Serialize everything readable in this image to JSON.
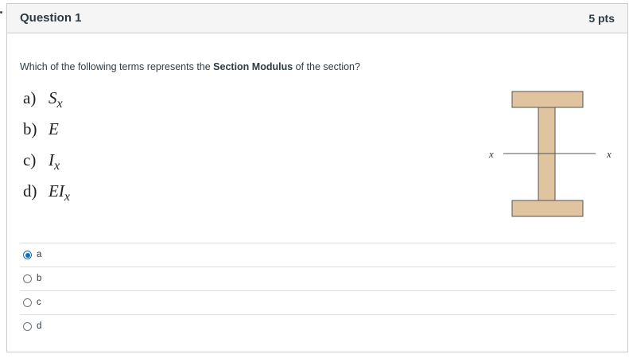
{
  "question": {
    "title": "Question 1",
    "points": "5 pts",
    "prompt_before": "Which of the following terms represents the ",
    "prompt_bold": "Section Modulus",
    "prompt_after": " of the section?"
  },
  "math_options": [
    {
      "label": "a)",
      "symbol": "S",
      "sub": "x"
    },
    {
      "label": "b)",
      "symbol": "E",
      "sub": ""
    },
    {
      "label": "c)",
      "symbol": "I",
      "sub": "x"
    },
    {
      "label": "d)",
      "symbol": "EI",
      "sub": "x"
    }
  ],
  "figure": {
    "axis_label_left": "x",
    "axis_label_right": "x",
    "fill_color": "#e0c49f",
    "stroke_color": "#555555"
  },
  "answers": [
    {
      "label": "a",
      "selected": true
    },
    {
      "label": "b",
      "selected": false
    },
    {
      "label": "c",
      "selected": false
    },
    {
      "label": "d",
      "selected": false
    }
  ]
}
